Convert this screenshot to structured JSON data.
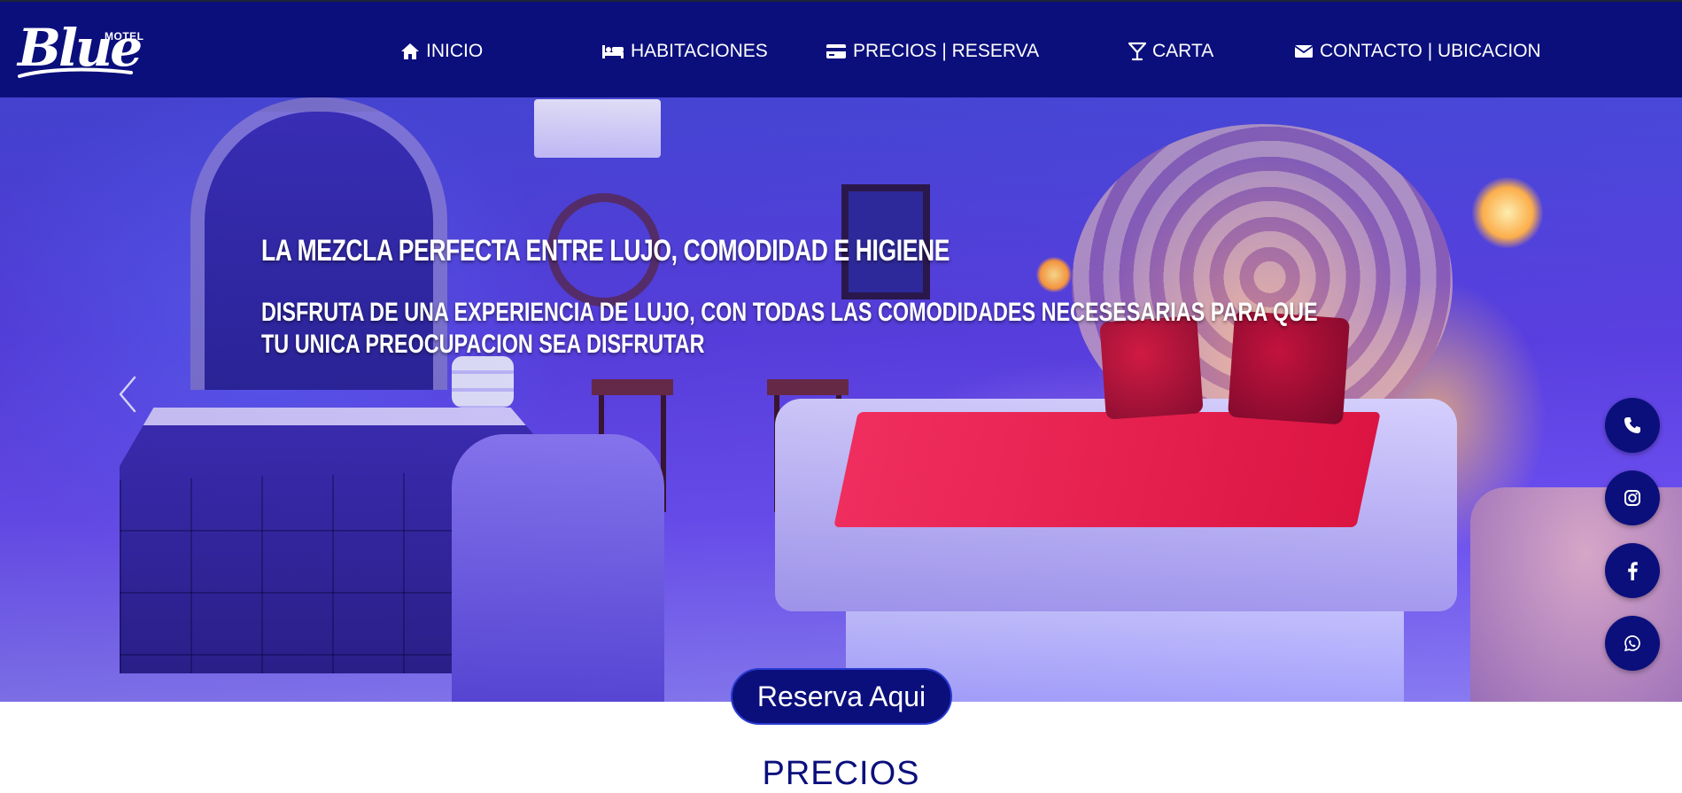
{
  "brand": {
    "logo_script": "Blue",
    "logo_small": "MOTEL"
  },
  "nav": {
    "items": [
      {
        "label": "INICIO",
        "icon": "home-icon"
      },
      {
        "label": "HABITACIONES",
        "icon": "bed-icon"
      },
      {
        "label": "PRECIOS | RESERVA",
        "icon": "credit-card-icon"
      },
      {
        "label": "CARTA",
        "icon": "cocktail-icon"
      },
      {
        "label": "CONTACTO | UBICACION",
        "icon": "envelope-icon"
      }
    ]
  },
  "hero": {
    "title": "LA MEZCLA PERFECTA ENTRE LUJO, COMODIDAD E HIGIENE",
    "subtitle": "DISFRUTA DE UNA EXPERIENCIA DE LUJO, CON TODAS LAS COMODIDADES NECESESARIAS PARA QUE TU UNICA PREOCUPACION SEA DISFRUTAR",
    "prev_icon": "chevron-left-icon"
  },
  "social": [
    {
      "name": "phone-icon"
    },
    {
      "name": "instagram-icon"
    },
    {
      "name": "facebook-icon"
    },
    {
      "name": "whatsapp-icon"
    }
  ],
  "reserve": {
    "label": "Reserva Aqui"
  },
  "section": {
    "title": "PRECIOS"
  },
  "colors": {
    "primary": "#0b0f7c",
    "white": "#ffffff"
  }
}
